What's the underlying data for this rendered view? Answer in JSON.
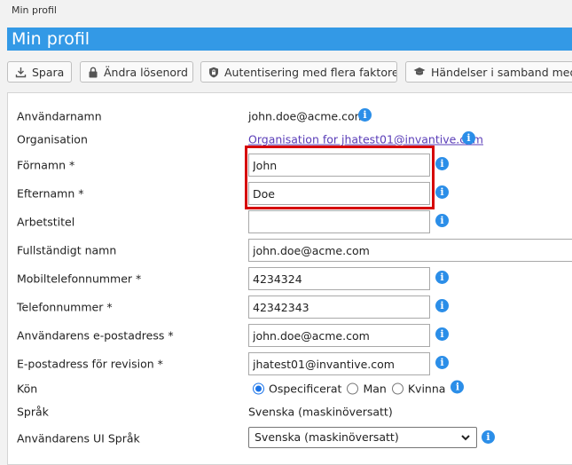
{
  "breadcrumb": "Min profil",
  "page_title": "Min profil",
  "toolbar": {
    "save_label": "Spara",
    "change_password_label": "Ändra lösenord",
    "mfa_label": "Autentisering med flera faktorer",
    "events_label": "Händelser i samband med a"
  },
  "fields": {
    "username": {
      "label": "Användarnamn",
      "value": "john.doe@acme.com"
    },
    "organisation": {
      "label": "Organisation",
      "value": "Organisation for jhatest01@invantive.com"
    },
    "first_name": {
      "label": "Förnamn *",
      "value": "John"
    },
    "last_name": {
      "label": "Efternamn *",
      "value": "Doe"
    },
    "job_title": {
      "label": "Arbetstitel",
      "value": ""
    },
    "full_name": {
      "label": "Fullständigt namn",
      "value": "john.doe@acme.com"
    },
    "mobile": {
      "label": "Mobiltelefonnummer *",
      "value": "4234324"
    },
    "phone": {
      "label": "Telefonnummer *",
      "value": "42342343"
    },
    "email": {
      "label": "Användarens e-postadress *",
      "value": "john.doe@acme.com"
    },
    "audit_email": {
      "label": "E-postadress för revision *",
      "value": "jhatest01@invantive.com"
    },
    "gender": {
      "label": "Kön",
      "options": [
        "Ospecificerat",
        "Man",
        "Kvinna"
      ],
      "selected": "Ospecificerat"
    },
    "language": {
      "label": "Språk",
      "value": "Svenska (maskinöversatt)"
    },
    "ui_language": {
      "label": "Användarens UI Språk",
      "value": "Svenska (maskinöversatt)"
    }
  },
  "colors": {
    "title_bar": "#3399e6",
    "info_icon": "#2b8ee8",
    "link": "#5a3db8",
    "highlight": "#d60000"
  }
}
